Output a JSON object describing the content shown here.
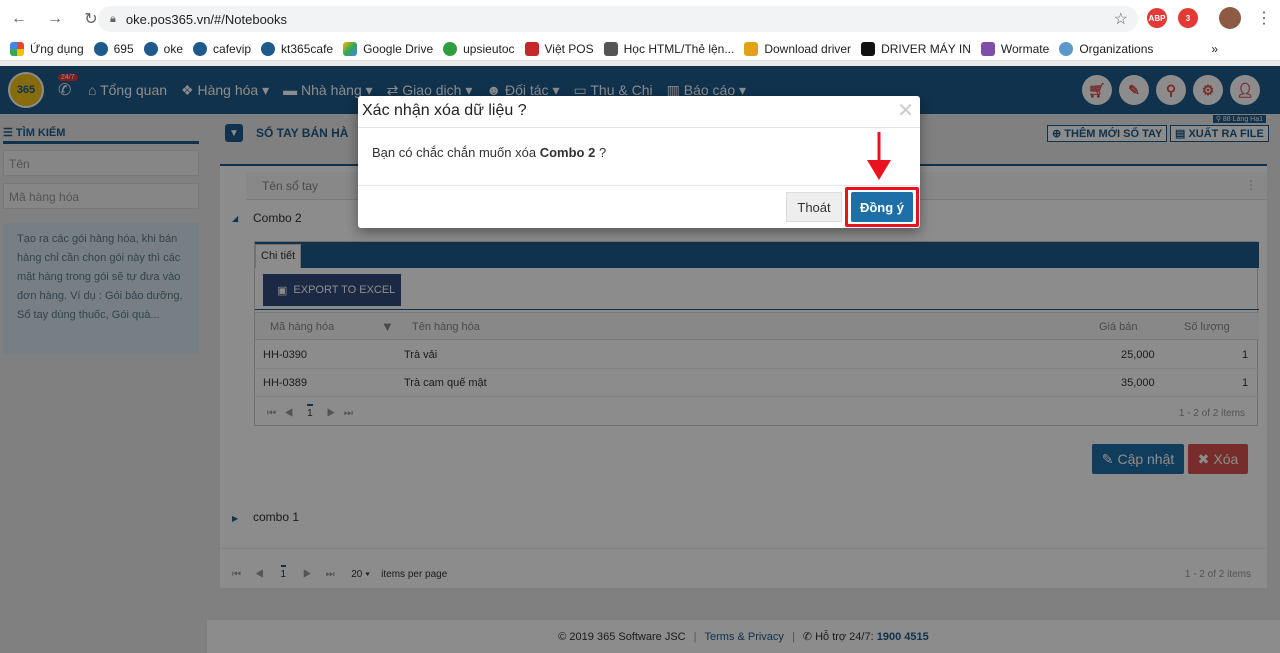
{
  "browser": {
    "url": "oke.pos365.vn/#/Notebooks",
    "ext_abp": "ABP",
    "ext_badge": "3",
    "bookmarks": [
      "Ứng dụng",
      "695",
      "oke",
      "cafevip",
      "kt365cafe",
      "Google Drive",
      "upsieutoc",
      "Việt POS",
      "Học HTML/Thẻ lện...",
      "Download driver",
      "DRIVER MÁY IN",
      "Wormate",
      "Organizations"
    ],
    "overflow": "»"
  },
  "header": {
    "logo": "365",
    "badge": "24/7",
    "menu": [
      "Tổng quan",
      "Hàng hóa ▾",
      "Nhà hàng ▾",
      "Giao dịch ▾",
      "Đối tác ▾",
      "Thu & Chi",
      "Báo cáo ▾"
    ]
  },
  "sidebar": {
    "title": "TÌM KIẾM",
    "name_placeholder": "Tên",
    "code_placeholder": "Mã hàng hóa",
    "info": "Tạo ra các gói hàng hóa, khi bán hàng chỉ cần chọn gói này thì các mặt hàng trong gói sẽ tự đưa vào đơn hàng. Ví dụ : Gói bảo dưỡng, Sổ tay dùng thuốc, Gói quà..."
  },
  "main": {
    "title": "SỔ TAY BÁN HÀ",
    "add_button": "THÊM MỚI SỔ TAY",
    "export_file_button": "XUẤT RA FILE",
    "address": "88 Láng Hạ1",
    "grid_header": "Tên sổ tay",
    "row1": "Combo 2",
    "row2": "combo 1",
    "detail_tab": "Chi tiết",
    "export_excel": "EXPORT TO EXCEL",
    "columns": [
      "Mã hàng hóa",
      "Tên hàng hóa",
      "Giá bán",
      "Số lượng"
    ],
    "rows": [
      {
        "code": "HH-0390",
        "name": "Trà vải",
        "price": "25,000",
        "qty": "1"
      },
      {
        "code": "HH-0389",
        "name": "Trà cam quế mật",
        "price": "35,000",
        "qty": "1"
      }
    ],
    "inner_page": "1",
    "inner_count": "1 - 2 of 2 items",
    "update_button": "Cập nhật",
    "delete_button": "Xóa",
    "outer_page": "1",
    "per_page": "20",
    "per_page_label": "items per page",
    "outer_count": "1 - 2 of 2 items"
  },
  "footer": {
    "copyright": "© 2019 365 Software JSC",
    "terms": "Terms & Privacy",
    "support_label": "Hỗ trợ 24/7:",
    "support_phone": "1900 4515"
  },
  "modal": {
    "title": "Xác nhận xóa dữ liệu ?",
    "body_prefix": "Bạn có chắc chắn muốn xóa",
    "body_item": "Combo 2",
    "body_suffix": "?",
    "cancel": "Thoát",
    "confirm": "Đồng ý"
  },
  "colors": {
    "brand": "#1e5b8c",
    "danger": "#d9534f",
    "highlight": "#e8131f"
  }
}
